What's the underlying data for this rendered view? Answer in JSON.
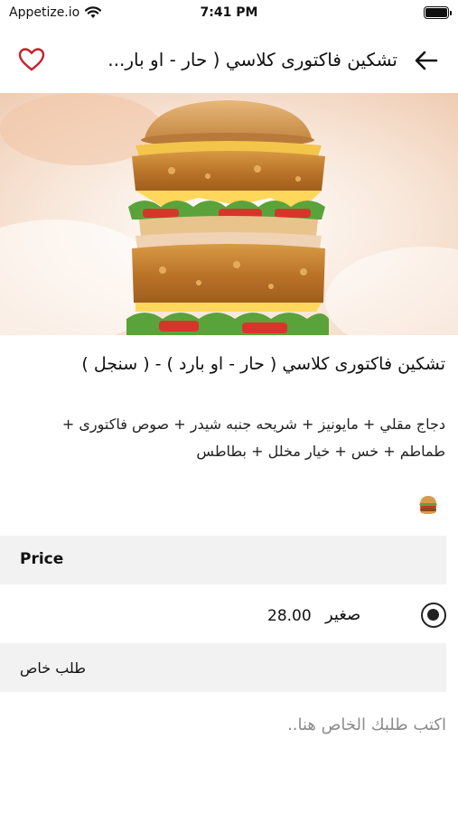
{
  "status_bar": {
    "carrier": "Appetize.io",
    "time": "7:41 PM",
    "wifi_icon": "wifi-icon",
    "battery_icon": "battery-icon"
  },
  "header": {
    "title": "تشكين فاكتورى كلاسي ( حار - او بار...",
    "favorite_icon": "heart-outline-icon",
    "back_icon": "arrow-back-icon"
  },
  "product": {
    "image": "burger-photo",
    "title": "تشكين فاكتورى كلاسي ( حار - او بارد ) - ( سنجل )",
    "description": "دجاج مقلي + مايونيز + شريحه جنبه شيدر + صوص فاكتورى + طماطم + خس + خيار مخلل + بطاطس",
    "thumbnail_icon": "burger-emoji-icon"
  },
  "price_section": {
    "header": "Price",
    "options": [
      {
        "name": "صغير",
        "price": "28.00",
        "selected": true
      }
    ]
  },
  "note_section": {
    "header": "طلب خاص",
    "placeholder": "اكتب طلبك الخاص هنا..",
    "value": ""
  },
  "colors": {
    "accent": "#c8202a",
    "section_bg": "#f2f2f2",
    "text": "#111111",
    "placeholder": "#8c8c8c"
  }
}
